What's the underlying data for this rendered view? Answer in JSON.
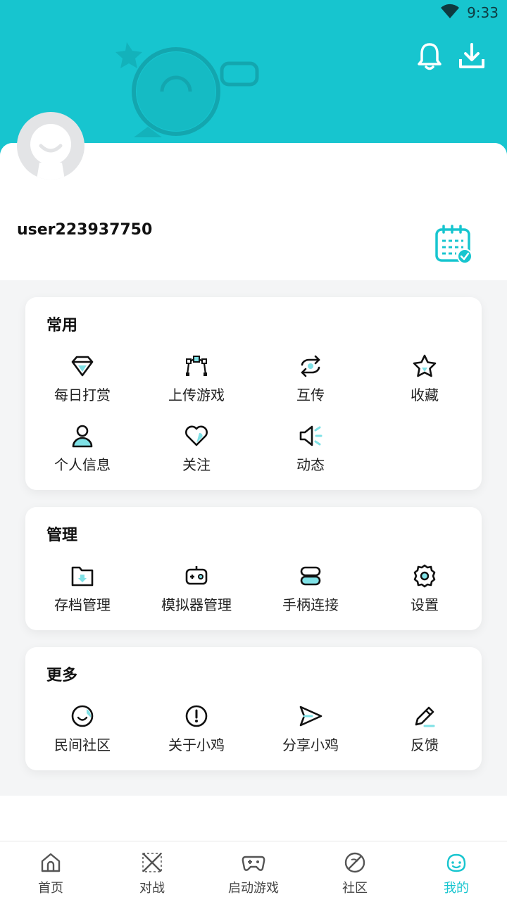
{
  "status_bar": {
    "time": "9:33",
    "wifi_icon": "wifi-icon"
  },
  "header": {
    "bell_icon": "bell-icon",
    "download_icon": "download-icon",
    "background_color": "#17c5cf"
  },
  "profile": {
    "username": "user223937750",
    "checkin_icon": "calendar-check-icon"
  },
  "sections": [
    {
      "title": "常用",
      "items": [
        {
          "label": "每日打赏",
          "icon": "diamond-icon"
        },
        {
          "label": "上传游戏",
          "icon": "upload-nodes-icon"
        },
        {
          "label": "互传",
          "icon": "transfer-icon"
        },
        {
          "label": "收藏",
          "icon": "star-icon"
        },
        {
          "label": "个人信息",
          "icon": "person-icon"
        },
        {
          "label": "关注",
          "icon": "heart-icon"
        },
        {
          "label": "动态",
          "icon": "speaker-icon"
        }
      ]
    },
    {
      "title": "管理",
      "items": [
        {
          "label": "存档管理",
          "icon": "folder-icon"
        },
        {
          "label": "模拟器管理",
          "icon": "emulator-icon"
        },
        {
          "label": "手柄连接",
          "icon": "link-icon"
        },
        {
          "label": "设置",
          "icon": "gear-icon"
        }
      ]
    },
    {
      "title": "更多",
      "items": [
        {
          "label": "民间社区",
          "icon": "smile-icon"
        },
        {
          "label": "关于小鸡",
          "icon": "info-icon"
        },
        {
          "label": "分享小鸡",
          "icon": "send-icon"
        },
        {
          "label": "反馈",
          "icon": "pencil-icon"
        }
      ]
    }
  ],
  "tabbar": [
    {
      "label": "首页",
      "icon": "home-icon",
      "active": false
    },
    {
      "label": "对战",
      "icon": "swords-icon",
      "active": false
    },
    {
      "label": "启动游戏",
      "icon": "gamepad-icon",
      "active": false
    },
    {
      "label": "社区",
      "icon": "planet-icon",
      "active": false
    },
    {
      "label": "我的",
      "icon": "face-icon",
      "active": true
    }
  ],
  "colors": {
    "accent": "#17c5cf",
    "text": "#111111"
  }
}
